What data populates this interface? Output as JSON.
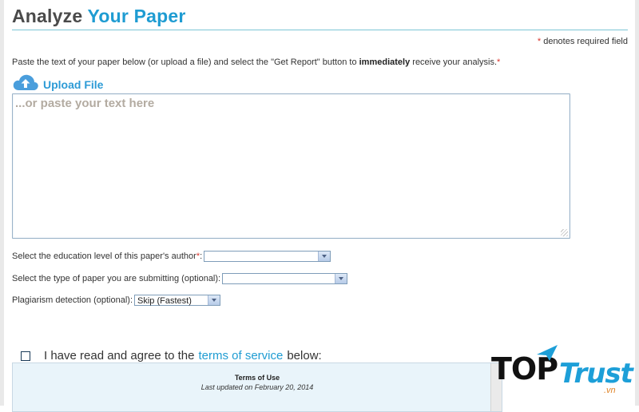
{
  "header": {
    "title_part1": "Analyze",
    "title_part2": "Your Paper",
    "required_note": "denotes required field",
    "required_marker": "*"
  },
  "instructions": {
    "before": "Paste the text of your paper below (or upload a file) and select the \"Get Report\" button to ",
    "emphasis": "immediately",
    "after": " receive your analysis."
  },
  "upload": {
    "label": "Upload File",
    "icon": "cloud-upload-icon"
  },
  "paper_input": {
    "placeholder": "...or paste your text here",
    "value": ""
  },
  "education": {
    "label": "Select the education level of this paper's author",
    "selected": ""
  },
  "paper_type": {
    "label": "Select the type of paper you are submitting (optional):",
    "selected": ""
  },
  "plagiarism": {
    "label": "Plagiarism detection (optional):",
    "selected": "Skip (Fastest)"
  },
  "agree": {
    "text_before": "I have read and agree to the",
    "link": "terms of service",
    "text_after": "below:",
    "checked": false
  },
  "terms": {
    "title": "Terms of Use",
    "updated": "Last updated on February 20, 2014"
  },
  "watermark": {
    "top": "TOP",
    "trust": "Trust",
    "suffix": ".vn"
  },
  "colors": {
    "accent": "#1f9cd2",
    "required": "#d9342b",
    "placeholder": "#b3aba1"
  }
}
